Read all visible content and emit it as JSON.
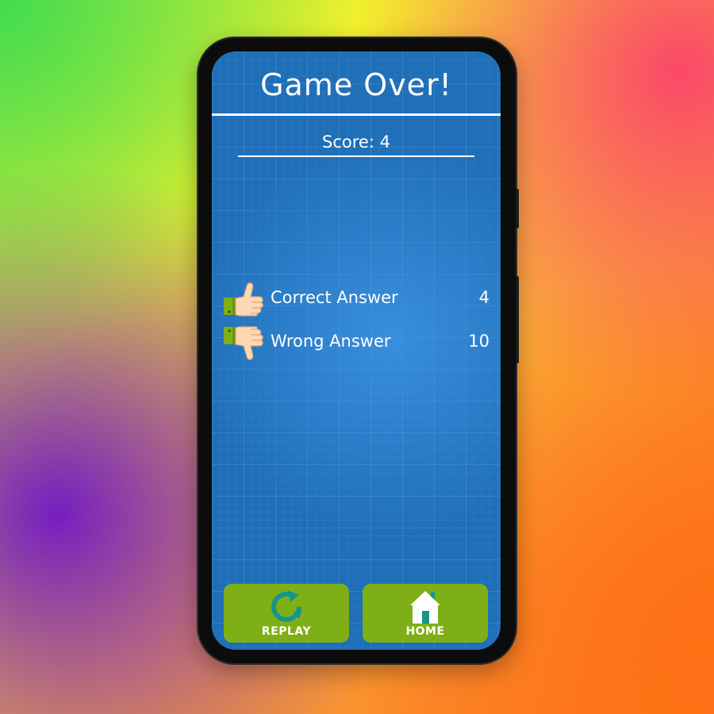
{
  "colors": {
    "screen_background": "#1f6fb8",
    "button_green": "#7faf16",
    "icon_teal": "#17958a",
    "text": "#ffffff"
  },
  "header": {
    "title": "Game Over!"
  },
  "score": {
    "label": "Score: 4"
  },
  "results": [
    {
      "label": "Correct Answer",
      "value": "4",
      "icon": "thumbs-up-icon"
    },
    {
      "label": "Wrong Answer",
      "value": "10",
      "icon": "thumbs-down-icon"
    }
  ],
  "buttons": {
    "replay": {
      "label": "REPLAY",
      "icon": "replay-icon"
    },
    "home": {
      "label": "HOME",
      "icon": "home-icon"
    }
  }
}
